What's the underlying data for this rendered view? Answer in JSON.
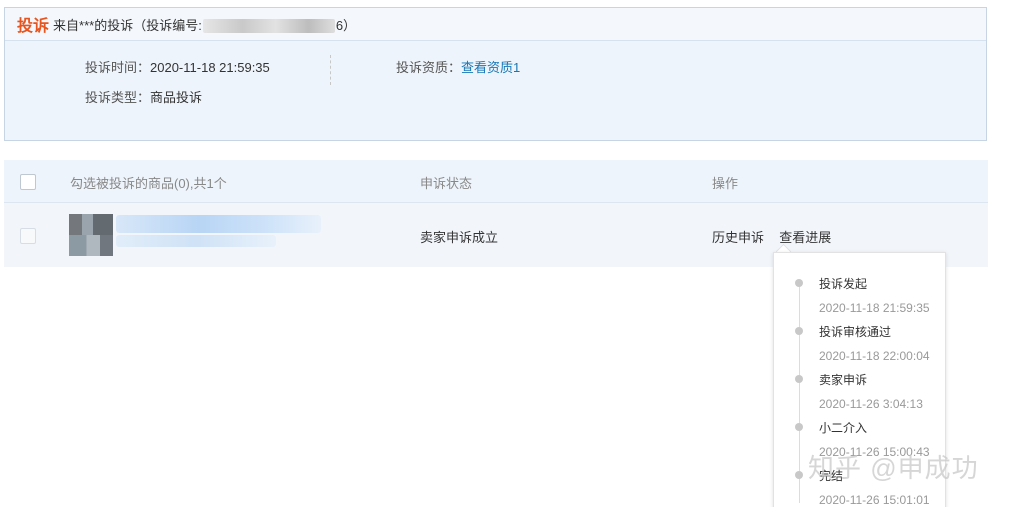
{
  "complaint": {
    "title": "投诉",
    "source_prefix": "来自***的投诉（投诉编号:",
    "source_suffix": "6）",
    "time_label": "投诉时间：",
    "time_value": "2020-11-18 21:59:35",
    "qualification_label": "投诉资质：",
    "qualification_link": "查看资质1",
    "type_label": "投诉类型：",
    "type_value": "商品投诉"
  },
  "table": {
    "headers": {
      "goods": "勾选被投诉的商品(0),共1个",
      "status": "申诉状态",
      "action": "操作"
    },
    "rows": [
      {
        "status": "卖家申诉成立",
        "actions": [
          "历史申诉",
          "查看进展"
        ]
      }
    ]
  },
  "progress": {
    "steps": [
      {
        "title": "投诉发起",
        "time": "2020-11-18 21:59:35"
      },
      {
        "title": "投诉审核通过",
        "time": "2020-11-18 22:00:04"
      },
      {
        "title": "卖家申诉",
        "time": "2020-11-26 3:04:13"
      },
      {
        "title": "小二介入",
        "time": "2020-11-26 15:00:43"
      },
      {
        "title": "完结",
        "time": "2020-11-26 15:01:01"
      }
    ]
  },
  "watermark": "知乎 @申成功",
  "colors": {
    "accent": "#e8541e",
    "link": "#1777b5",
    "panel_bg": "#eef4fb"
  }
}
